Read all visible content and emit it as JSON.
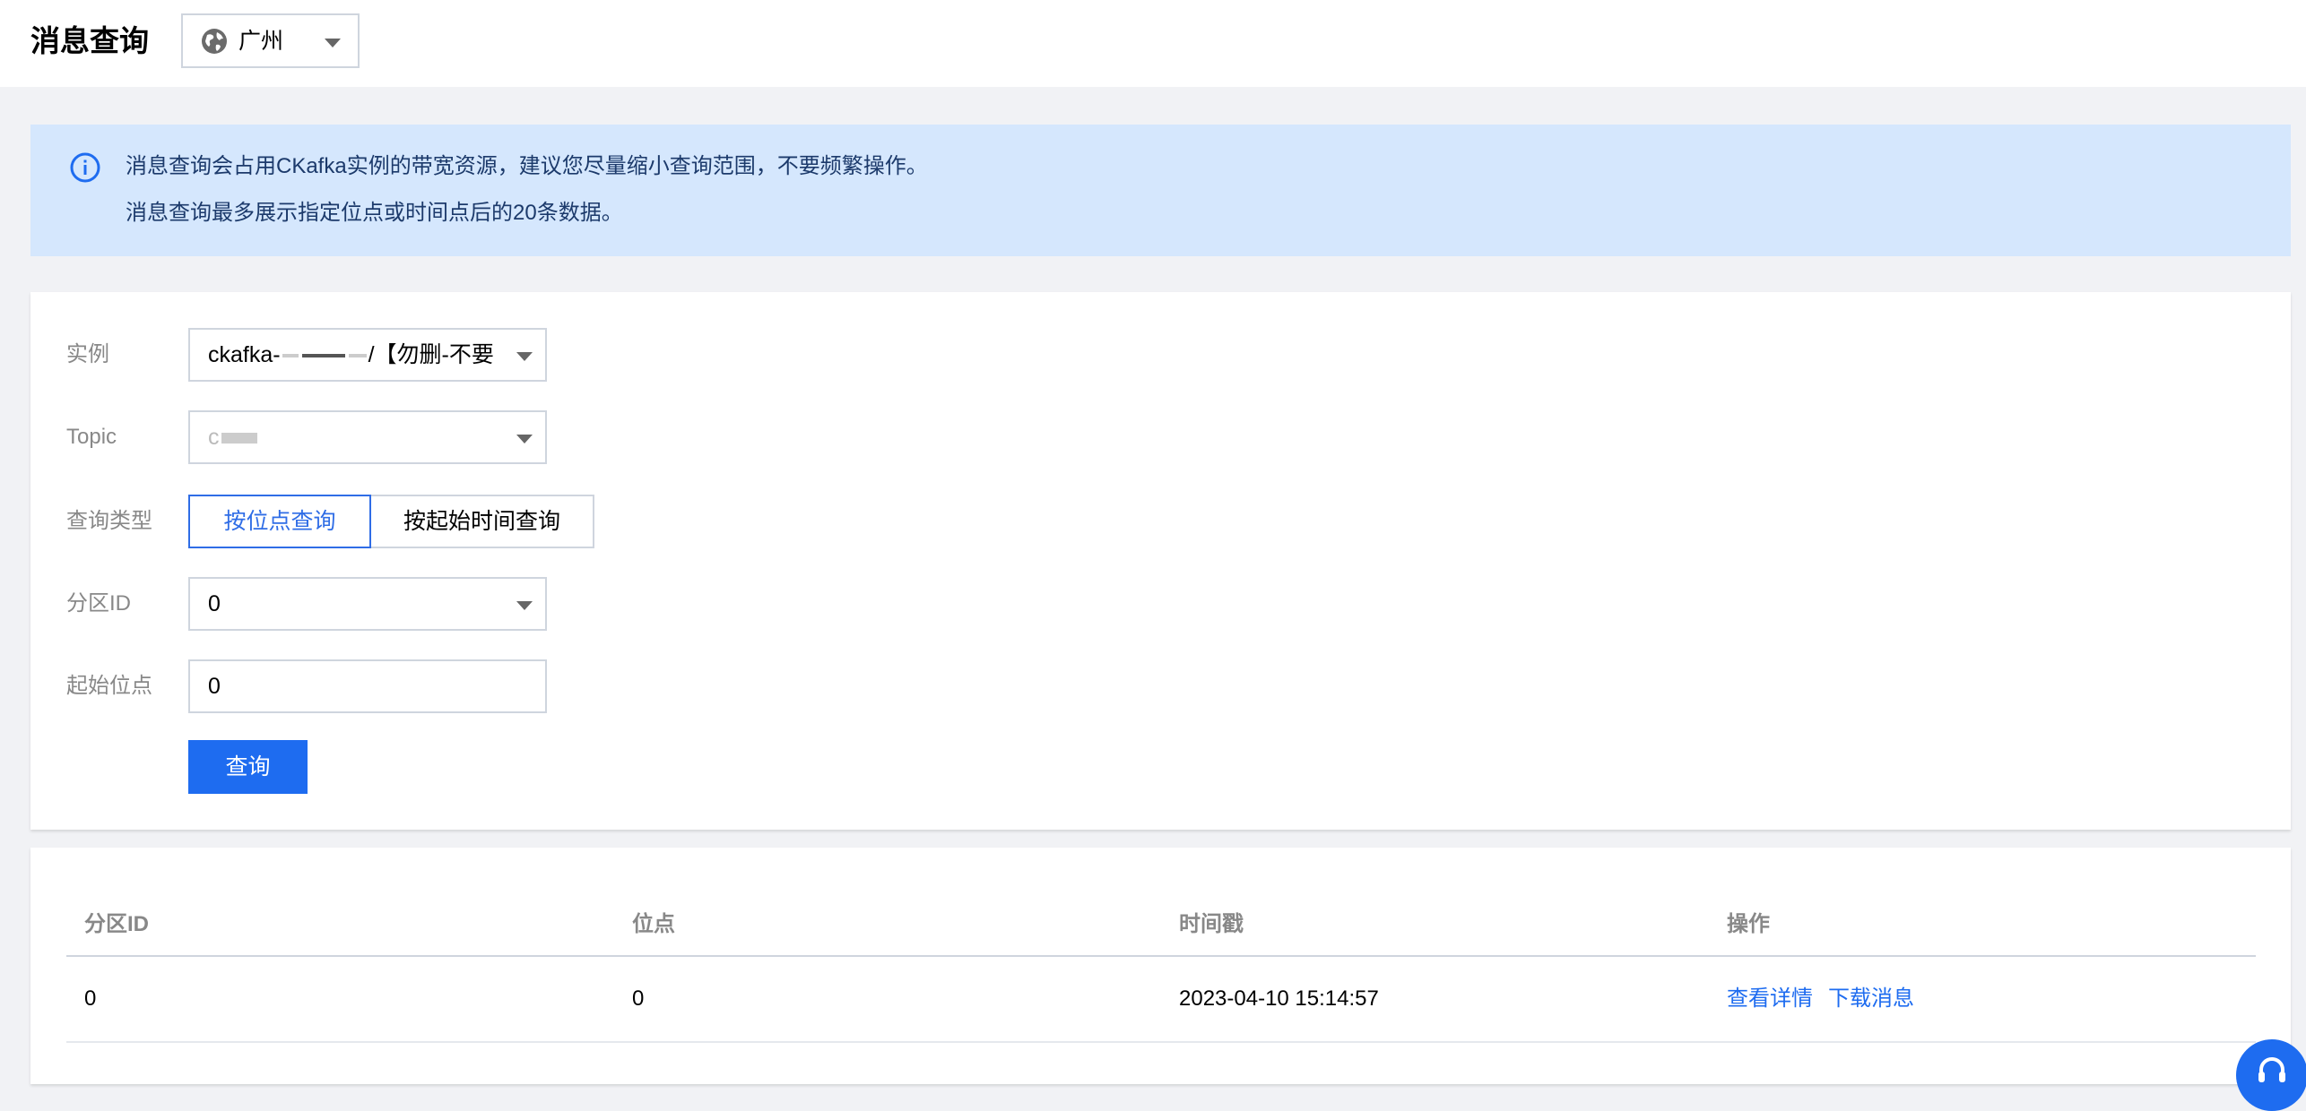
{
  "header": {
    "title": "消息查询",
    "region_label": "广州",
    "region_icon": "globe-icon"
  },
  "notice": {
    "icon": "info-icon",
    "line1": "消息查询会占用CKafka实例的带宽资源，建议您尽量缩小查询范围，不要频繁操作。",
    "line2": "消息查询最多展示指定位点或时间点后的20条数据。"
  },
  "form": {
    "instance_label": "实例",
    "instance_value_prefix": "ckafka-",
    "instance_value_suffix": "/【勿删-不要",
    "topic_label": "Topic",
    "topic_value": "c",
    "query_type_label": "查询类型",
    "query_type_options": [
      "按位点查询",
      "按起始时间查询"
    ],
    "query_type_selected": "按位点查询",
    "partition_label": "分区ID",
    "partition_value": "0",
    "start_offset_label": "起始位点",
    "start_offset_value": "0",
    "submit_label": "查询"
  },
  "table": {
    "columns": [
      "分区ID",
      "位点",
      "时间戳",
      "操作"
    ],
    "rows": [
      {
        "partition": "0",
        "offset": "0",
        "timestamp": "2023-04-10 15:14:57",
        "actions": [
          "查看详情",
          "下载消息"
        ]
      }
    ]
  },
  "colors": {
    "accent": "#1e6cf0",
    "notice_bg": "#d5e7fd",
    "page_bg": "#f1f2f5"
  }
}
